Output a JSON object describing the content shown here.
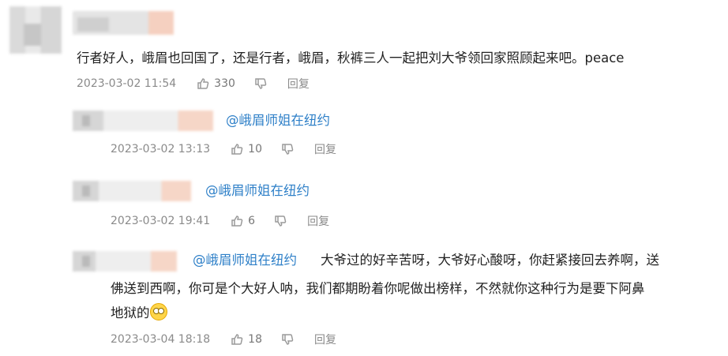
{
  "main_comment": {
    "text": "行者好人，峨眉也回国了，还是行者，峨眉，秋裤三人一起把刘大爷领回家照顾起来吧。peace",
    "date": "2023-03-02 11:54",
    "likes": "330",
    "reply_label": "回复"
  },
  "replies": [
    {
      "mention": "@峨眉师姐在纽约",
      "text": "",
      "date": "2023-03-02 13:13",
      "likes": "10",
      "reply_label": "回复"
    },
    {
      "mention": "@峨眉师姐在纽约",
      "text": "",
      "date": "2023-03-02 19:41",
      "likes": "6",
      "reply_label": "回复"
    },
    {
      "mention": "@峨眉师姐在纽约",
      "text_line1": "大爷过的好辛苦呀，大爷好心酸呀，你赶紧接回去养啊，送",
      "text_line2": "佛送到西啊，你可是个大好人呐，我们都期盼着你呢做出榜样，不然就你这种行为是要下阿鼻",
      "text_line3": "地狱的",
      "emoji": "dizzy-face-emoji",
      "date": "2023-03-04 18:18",
      "likes": "18",
      "reply_label": "回复"
    }
  ],
  "icons": {
    "like": "thumbs-up-icon",
    "dislike": "thumbs-down-icon"
  }
}
